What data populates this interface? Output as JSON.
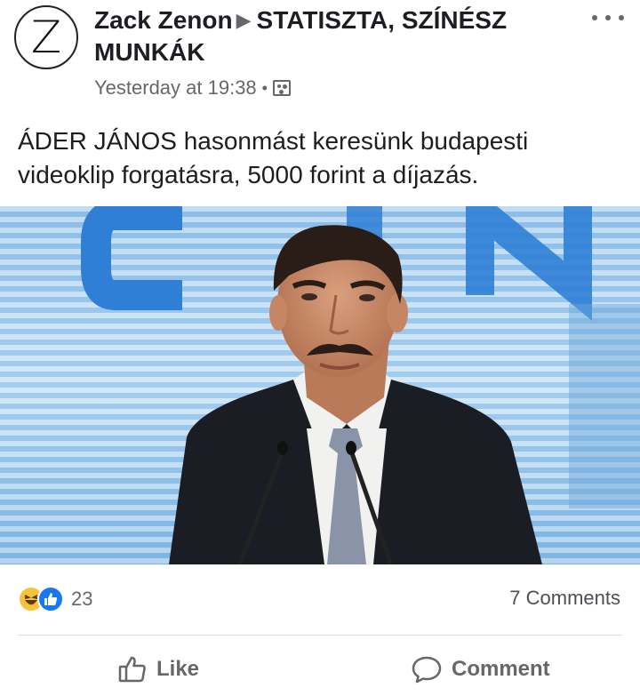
{
  "post": {
    "author_initial": "Z",
    "author_name": "Zack Zenon",
    "group_name": "STATISZTA, SZÍNÉSZ MUNKÁK",
    "timestamp": "Yesterday at 19:38",
    "privacy_icon": "group-icon",
    "more_icon": "more-options-icon",
    "text_line1": "ÁDER JÁNOS hasonmást keresünk budapesti",
    "text_line2": "videoklip forgatásra, 5000 forint a díjazás."
  },
  "reactions": {
    "icons": [
      "haha-reaction-icon",
      "like-reaction-icon"
    ],
    "count": "23",
    "comments": "7 Comments"
  },
  "actions": {
    "like_label": "Like",
    "comment_label": "Comment"
  },
  "colors": {
    "text": "#1c1e21",
    "secondary": "#65676b",
    "like_blue": "#1877f2",
    "haha_yellow": "#f7c33b",
    "backdrop_blue": "#2f7fd6"
  }
}
